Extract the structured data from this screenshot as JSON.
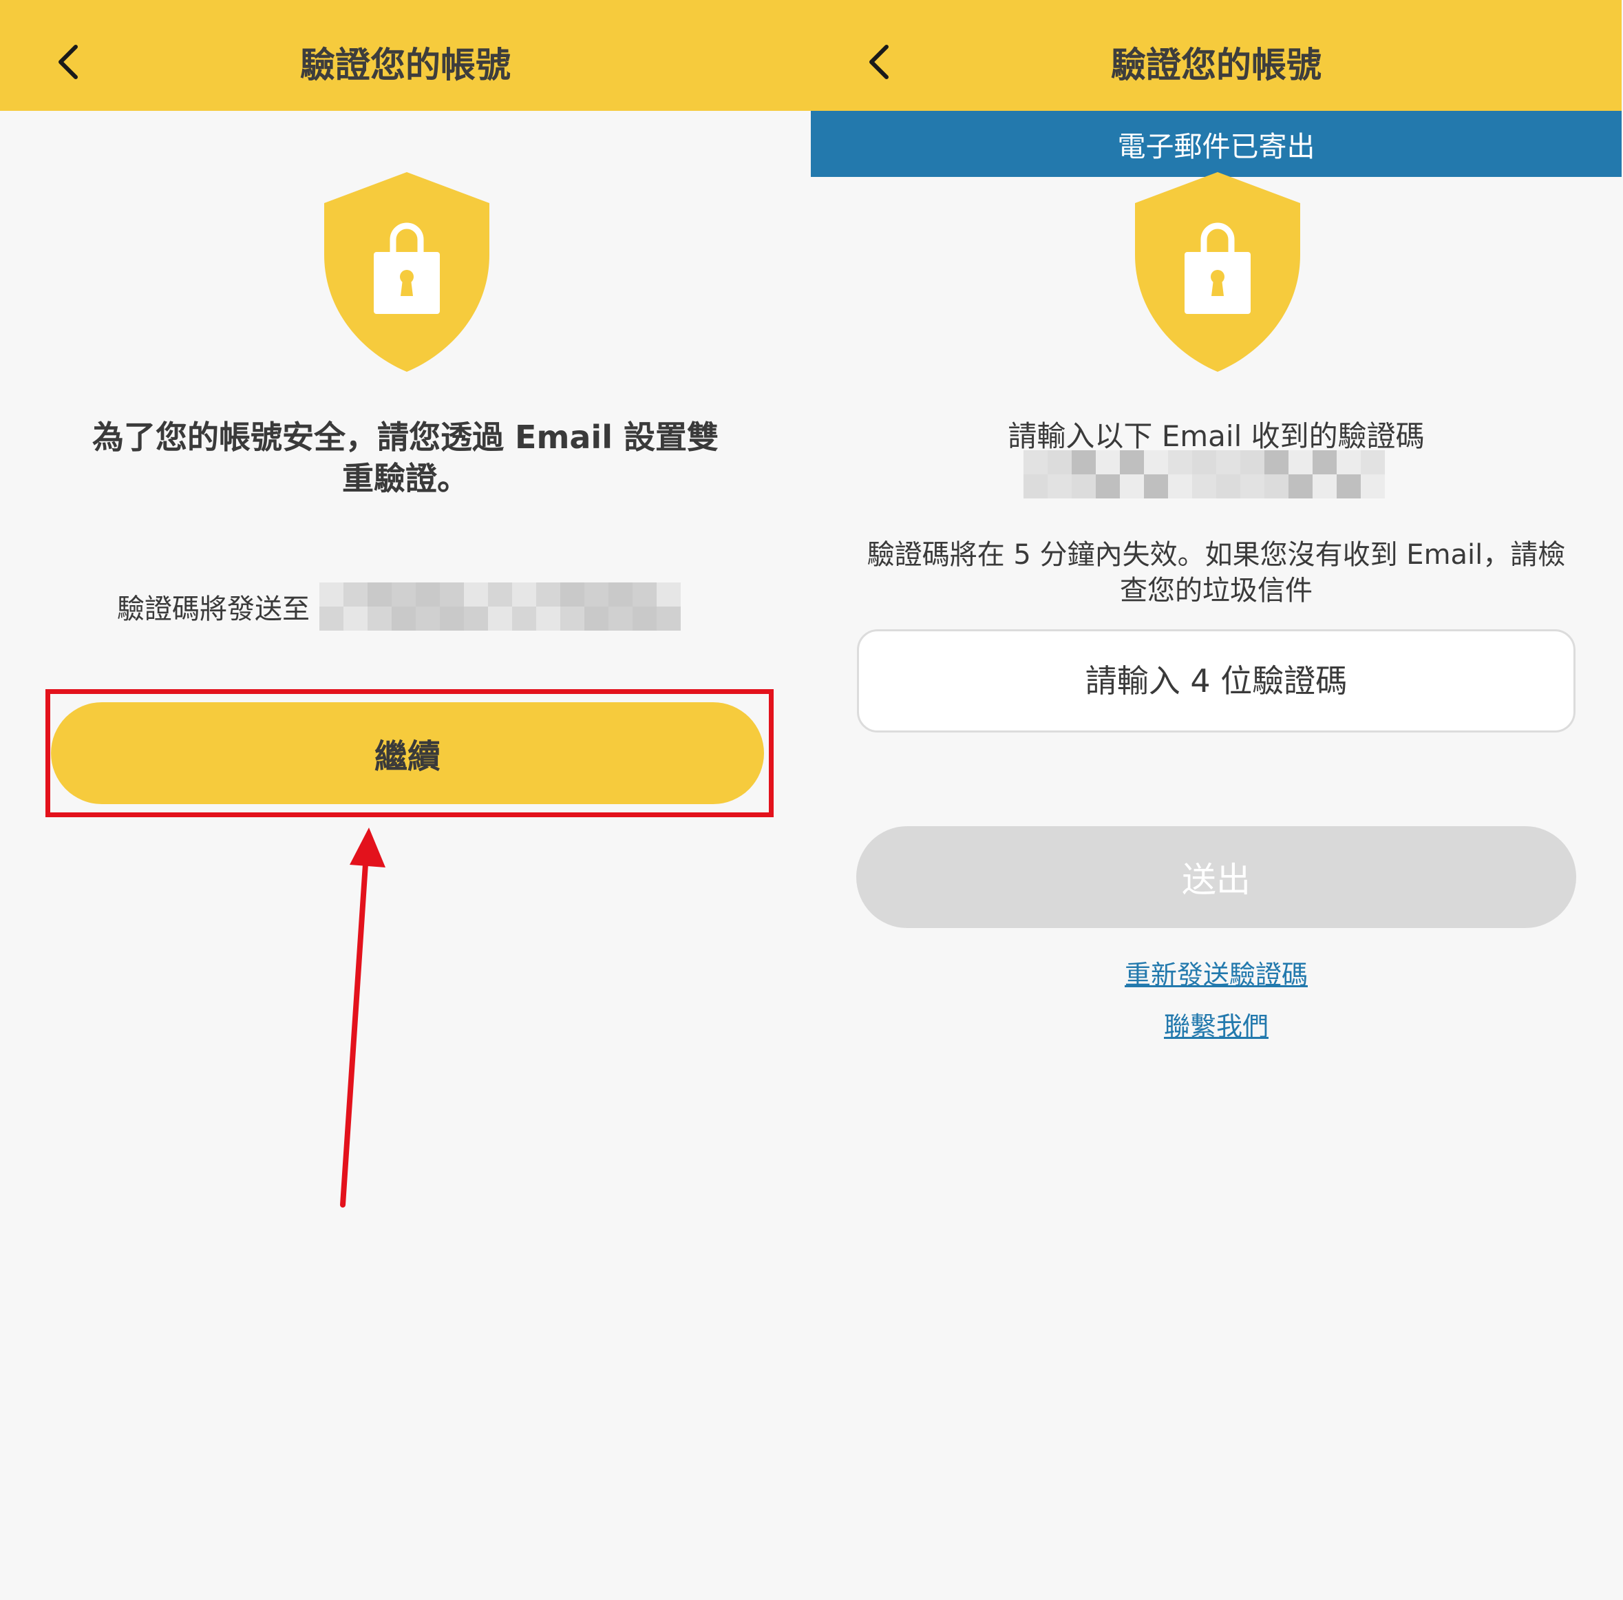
{
  "colors": {
    "accent_yellow": "#f6cb3d",
    "banner_blue": "#2379ad",
    "background": "#f7f7f7",
    "disabled_gray": "#d9d9d9",
    "annotation_red": "#e3121c"
  },
  "left": {
    "header": {
      "title": "驗證您的帳號",
      "back_icon": "chevron-left-icon"
    },
    "shield_icon": "shield-lock-icon",
    "heading_line1": "為了您的帳號安全，請您透過 Email 設置雙",
    "heading_line2": "重驗證。",
    "send_label": "驗證碼將發送至",
    "continue_button": "繼續"
  },
  "right": {
    "header": {
      "title": "驗證您的帳號",
      "back_icon": "chevron-left-icon"
    },
    "banner": "電子郵件已寄出",
    "shield_icon": "shield-lock-icon",
    "prompt": "請輸入以下 Email 收到的驗證碼",
    "info_line1": "驗證碼將在 5 分鐘內失效。如果您沒有收到 Email，請檢",
    "info_line2": "查您的垃圾信件",
    "code_input_placeholder": "請輸入 4 位驗證碼",
    "submit_button": "送出",
    "resend_link": "重新發送驗證碼",
    "contact_link": "聯繫我們"
  }
}
